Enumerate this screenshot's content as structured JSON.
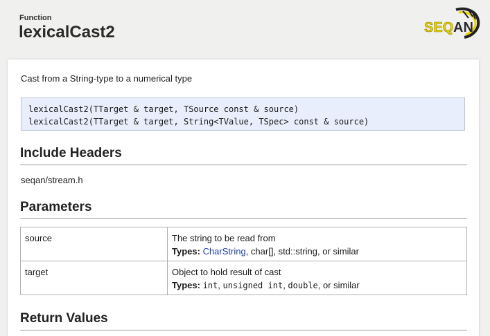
{
  "header": {
    "kind": "Function",
    "title": "lexicalCast2",
    "logo_text": "SEQAN"
  },
  "brief": "Cast from a String-type to a numerical type",
  "signatures": [
    "lexicalCast2(TTarget & target, TSource const & source)",
    "lexicalCast2(TTarget & target, String<TValue, TSpec> const & source)"
  ],
  "sections": {
    "include_headers": "Include Headers",
    "parameters": "Parameters",
    "return_values": "Return Values"
  },
  "include_header": "seqan/stream.h",
  "parameters": [
    {
      "name": "source",
      "description": "The string to be read from",
      "types_label": "Types:",
      "type_link": "CharString",
      "types_rest": ", char[], std::string, or similar"
    },
    {
      "name": "target",
      "description": "Object to hold result of cast",
      "types_label": "Types:",
      "type_code_1": "int",
      "sep_1": ", ",
      "type_code_2": "unsigned int",
      "sep_2": ", ",
      "type_code_3": "double",
      "types_rest": ", or similar"
    }
  ],
  "colors": {
    "link": "#1f3fa0",
    "logo_yellow": "#e6d200",
    "signature_bg": "#e8eefb"
  }
}
